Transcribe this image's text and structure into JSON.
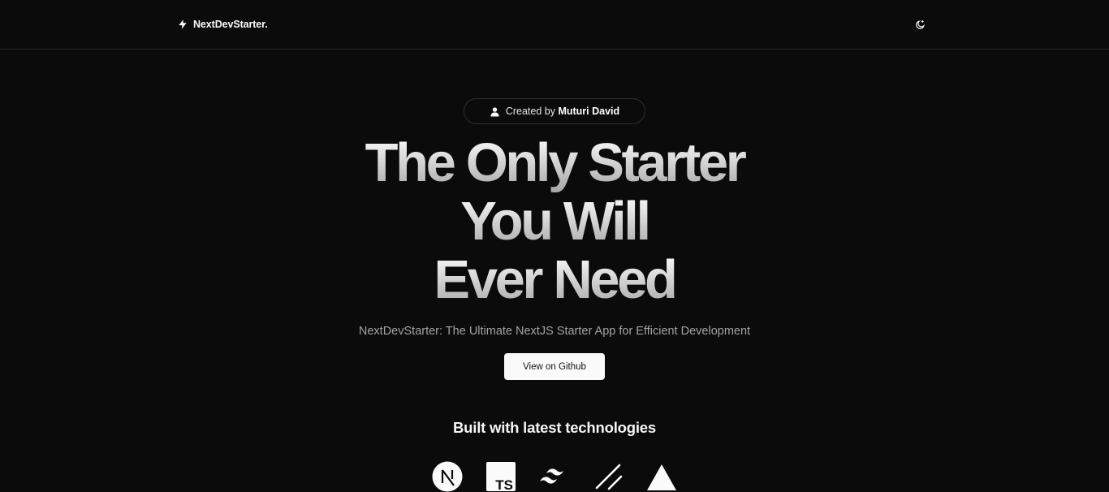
{
  "navbar": {
    "brand_prefix": "NextDev",
    "brand_suffix": "Starter.",
    "brand_icon": "lightning-icon",
    "theme_toggle_icon": "moon-sun-icon"
  },
  "hero": {
    "author_prefix": "Created by ",
    "author_name": "Muturi David",
    "author_icon": "user-icon",
    "headline": {
      "line1": "The Only Starter",
      "line2": "You Will",
      "line3": "Ever Need"
    },
    "subtitle": "NextDevStarter: The Ultimate NextJS Starter App for Efficient Development",
    "github_button": "View on Github"
  },
  "technologies": {
    "heading": "Built with latest technologies",
    "logos": [
      "nextjs-icon",
      "typescript-icon",
      "tailwindcss-icon",
      "shadcn-icon",
      "vercel-icon"
    ]
  },
  "colors": {
    "background": "#0b0b0b",
    "border": "#262626",
    "text": "#fafafa",
    "muted": "#a3a3a3",
    "button_bg": "#fafafa"
  }
}
